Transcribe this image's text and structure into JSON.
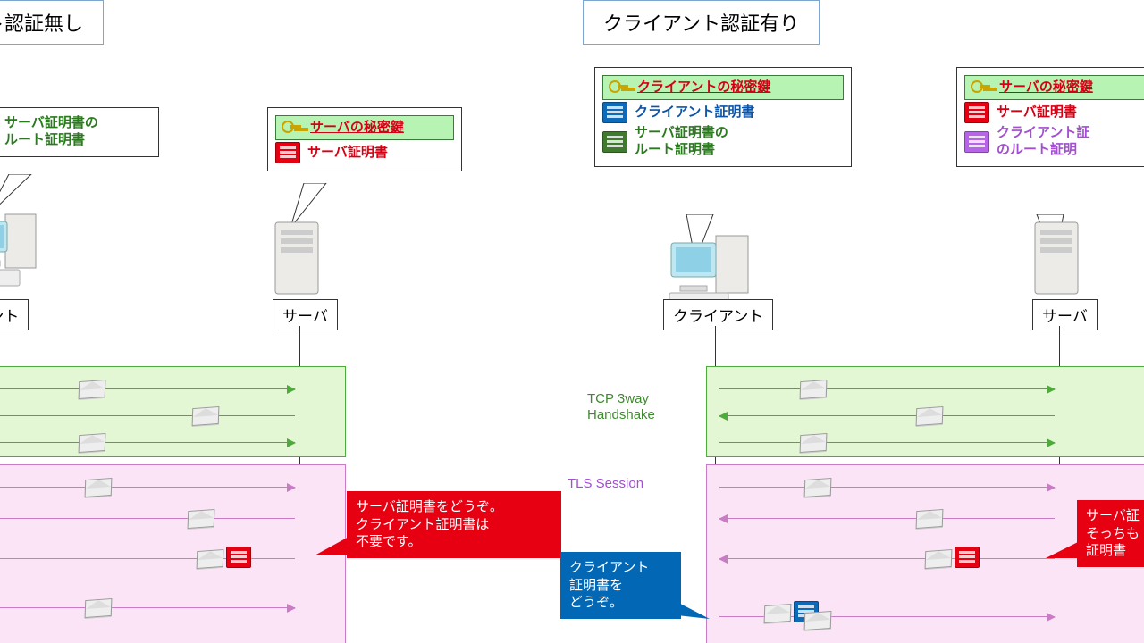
{
  "titles": {
    "left": "ト認証無し",
    "right": "クライアント認証有り"
  },
  "left": {
    "client_label": "アント",
    "server_label": "サーバ",
    "client_callout": {
      "root_cert_l1": "サーバ証明書の",
      "root_cert_l2": "ルート証明書"
    },
    "server_callout": {
      "key": "サーバの秘密鍵",
      "cert": "サーバ証明書"
    },
    "speech_red_l1": "サーバ証明書をどうぞ。",
    "speech_red_l2": "クライアント証明書は",
    "speech_red_l3": "不要です。"
  },
  "right": {
    "client_label": "クライアント",
    "server_label": "サーバ",
    "client_callout": {
      "key": "クライアントの秘密鍵",
      "cert": "クライアント証明書",
      "root_l1": "サーバ証明書の",
      "root_l2": "ルート証明書"
    },
    "server_callout": {
      "key": "サーバの秘密鍵",
      "cert": "サーバ証明書",
      "root_l1": "クライアント証",
      "root_l2": "のルート証明"
    },
    "speech_blue_l1": "クライアント",
    "speech_blue_l2": "証明書を",
    "speech_blue_l3": "どうぞ。",
    "speech_red_l1": "サーバ証",
    "speech_red_l2": "そっちも",
    "speech_red_l3": "証明書"
  },
  "mid": {
    "tcp_l1": "TCP 3way",
    "tcp_l2": "Handshake",
    "tls": "TLS Session"
  }
}
